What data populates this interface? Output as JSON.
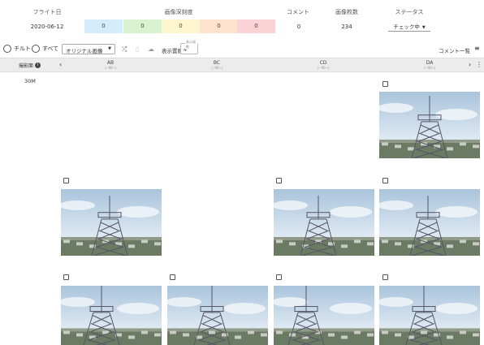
{
  "summary": {
    "headers": {
      "flight_date": "フライト日",
      "severity": "画像深刻度",
      "comment": "コメント",
      "image_count": "画像枚数",
      "status": "ステータス"
    },
    "values": {
      "flight_date": "2020-06-12",
      "severity_counts": [
        "0",
        "0",
        "0",
        "0",
        "0"
      ],
      "comment": "0",
      "image_count": "234",
      "status": "チェック中"
    },
    "severity_colors": [
      "#d4ecfb",
      "#d9f2cf",
      "#fdf6cf",
      "#fde3cd",
      "#f9d3d6"
    ]
  },
  "toolbar": {
    "radio_tilt": "チルト",
    "radio_all": "すべて",
    "image_type": "オリジナル画像",
    "display_count_label": "表示置数",
    "display_count_float": "表示枚数",
    "display_count_value": "4",
    "comment_list": "コメント一覧"
  },
  "colbar": {
    "shoot_label": "撮影面",
    "columns": [
      {
        "label": "AB",
        "sub": "|---90---|"
      },
      {
        "label": "BC",
        "sub": "|---90---|"
      },
      {
        "label": "CD",
        "sub": "|---90---|"
      },
      {
        "label": "DA",
        "sub": "|---90---|"
      }
    ]
  },
  "grid": {
    "row_label": "30M"
  }
}
